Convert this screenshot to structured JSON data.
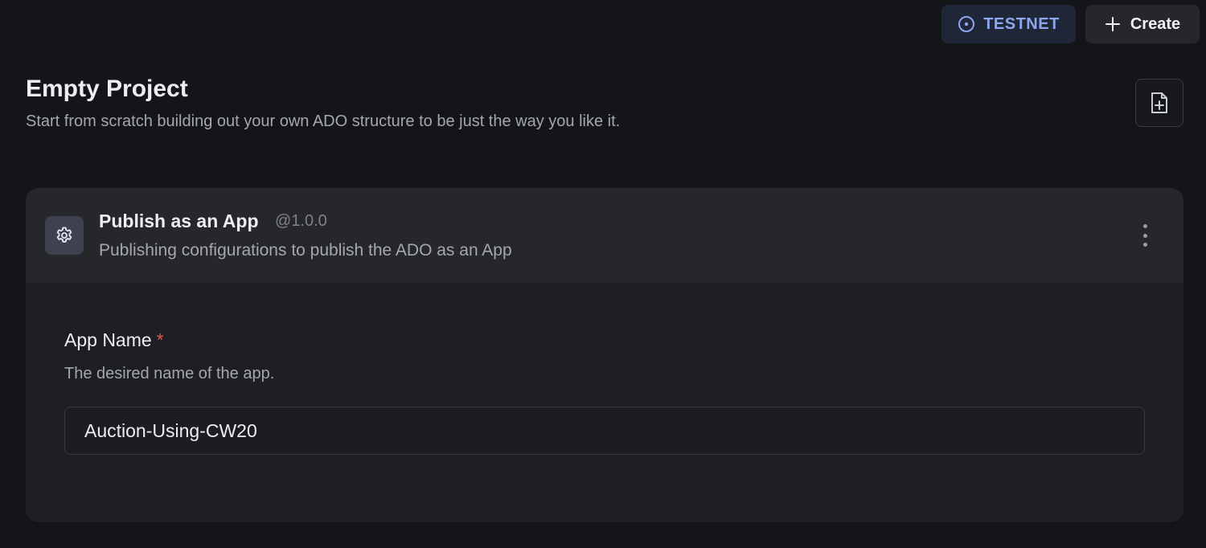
{
  "header": {
    "network_label": "TESTNET",
    "network_icon": "target-icon",
    "create_label": "Create",
    "create_icon": "plus-icon"
  },
  "page": {
    "title": "Empty Project",
    "subtitle": "Start from scratch building out your own ADO structure to be just the way you like it.",
    "add_file_icon": "file-plus-icon"
  },
  "card": {
    "icon": "gear-icon",
    "title": "Publish as an App",
    "version": "@1.0.0",
    "description": "Publishing configurations to publish the ADO as an App",
    "menu_icon": "more-vertical-icon",
    "field": {
      "label": "App Name",
      "required_marker": "*",
      "help": "The desired name of the app.",
      "value": "Auction-Using-CW20"
    }
  },
  "colors": {
    "background": "#141519",
    "card": "#1e1f23",
    "card_header": "#26272b",
    "network_accent": "#8ea6ee",
    "required": "#e5564f"
  }
}
